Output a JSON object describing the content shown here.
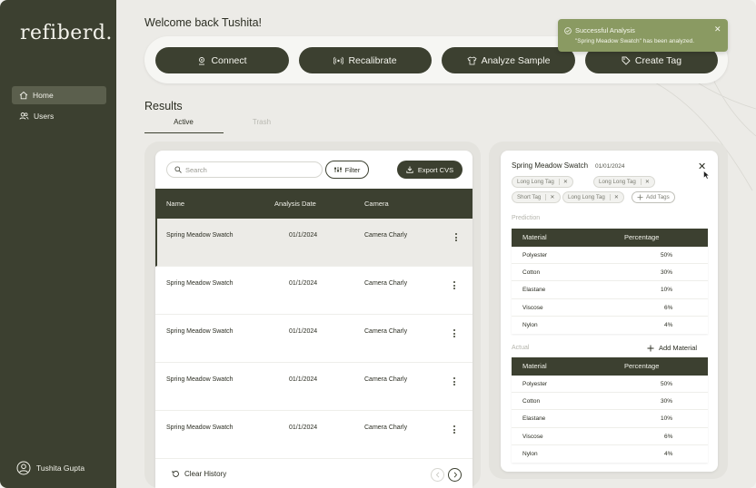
{
  "brand": {
    "logo": "refiberd."
  },
  "sidebar": {
    "items": [
      {
        "label": "Home",
        "icon": "home-icon",
        "active": true
      },
      {
        "label": "Users",
        "icon": "users-icon",
        "active": false
      }
    ],
    "user": {
      "name": "Tushita Gupta",
      "icon": "user-circle-icon"
    }
  },
  "header": {
    "welcome": "Welcome back Tushita!"
  },
  "actions": [
    {
      "label": "Connect",
      "icon": "connect-icon"
    },
    {
      "label": "Recalibrate",
      "icon": "signal-icon"
    },
    {
      "label": "Analyze Sample",
      "icon": "shirt-icon"
    },
    {
      "label": "Create Tag",
      "icon": "tag-icon"
    }
  ],
  "results": {
    "title": "Results",
    "tabs": [
      {
        "label": "Active"
      },
      {
        "label": "Trash"
      }
    ],
    "search_placeholder": "Search",
    "filter_label": "Filter",
    "export_label": "Export CVS",
    "columns": [
      "Name",
      "Analysis Date",
      "Camera"
    ],
    "rows": [
      {
        "name": "Spring Meadow Swatch",
        "date": "01/1/2024",
        "camera": "Camera Charly"
      },
      {
        "name": "Spring Meadow Swatch",
        "date": "01/1/2024",
        "camera": "Camera Charly"
      },
      {
        "name": "Spring Meadow Swatch",
        "date": "01/1/2024",
        "camera": "Camera Charly"
      },
      {
        "name": "Spring Meadow Swatch",
        "date": "01/1/2024",
        "camera": "Camera Charly"
      },
      {
        "name": "Spring Meadow Swatch",
        "date": "01/1/2024",
        "camera": "Camera Charly"
      }
    ],
    "clear_history": "Clear History"
  },
  "detail": {
    "title": "Spring Meadow Swatch",
    "date": "01/01/2024",
    "tags": [
      "Long Long Tag",
      "Long Long Tag",
      "Short Tag",
      "Long Long Tag"
    ],
    "add_tags": "Add Tags",
    "prediction_label": "Prediction",
    "actual_label": "Actual",
    "add_material": "Add Material",
    "columns": [
      "Material",
      "Percentage"
    ],
    "prediction": [
      {
        "material": "Polyester",
        "pct": "50%"
      },
      {
        "material": "Cotton",
        "pct": "30%"
      },
      {
        "material": "Elastane",
        "pct": "10%"
      },
      {
        "material": "Viscose",
        "pct": "6%"
      },
      {
        "material": "Nylon",
        "pct": "4%"
      }
    ],
    "actual": [
      {
        "material": "Polyester",
        "pct": "50%"
      },
      {
        "material": "Cotton",
        "pct": "30%"
      },
      {
        "material": "Elastane",
        "pct": "10%"
      },
      {
        "material": "Viscose",
        "pct": "6%"
      },
      {
        "material": "Nylon",
        "pct": "4%"
      }
    ]
  },
  "toast": {
    "title": "Successful Analysis",
    "message": "\"Spring Meadow Swatch\" has been analyzed."
  },
  "colors": {
    "primary": "#3c4030",
    "toast": "#8a9a62",
    "background": "#ecebe7"
  }
}
